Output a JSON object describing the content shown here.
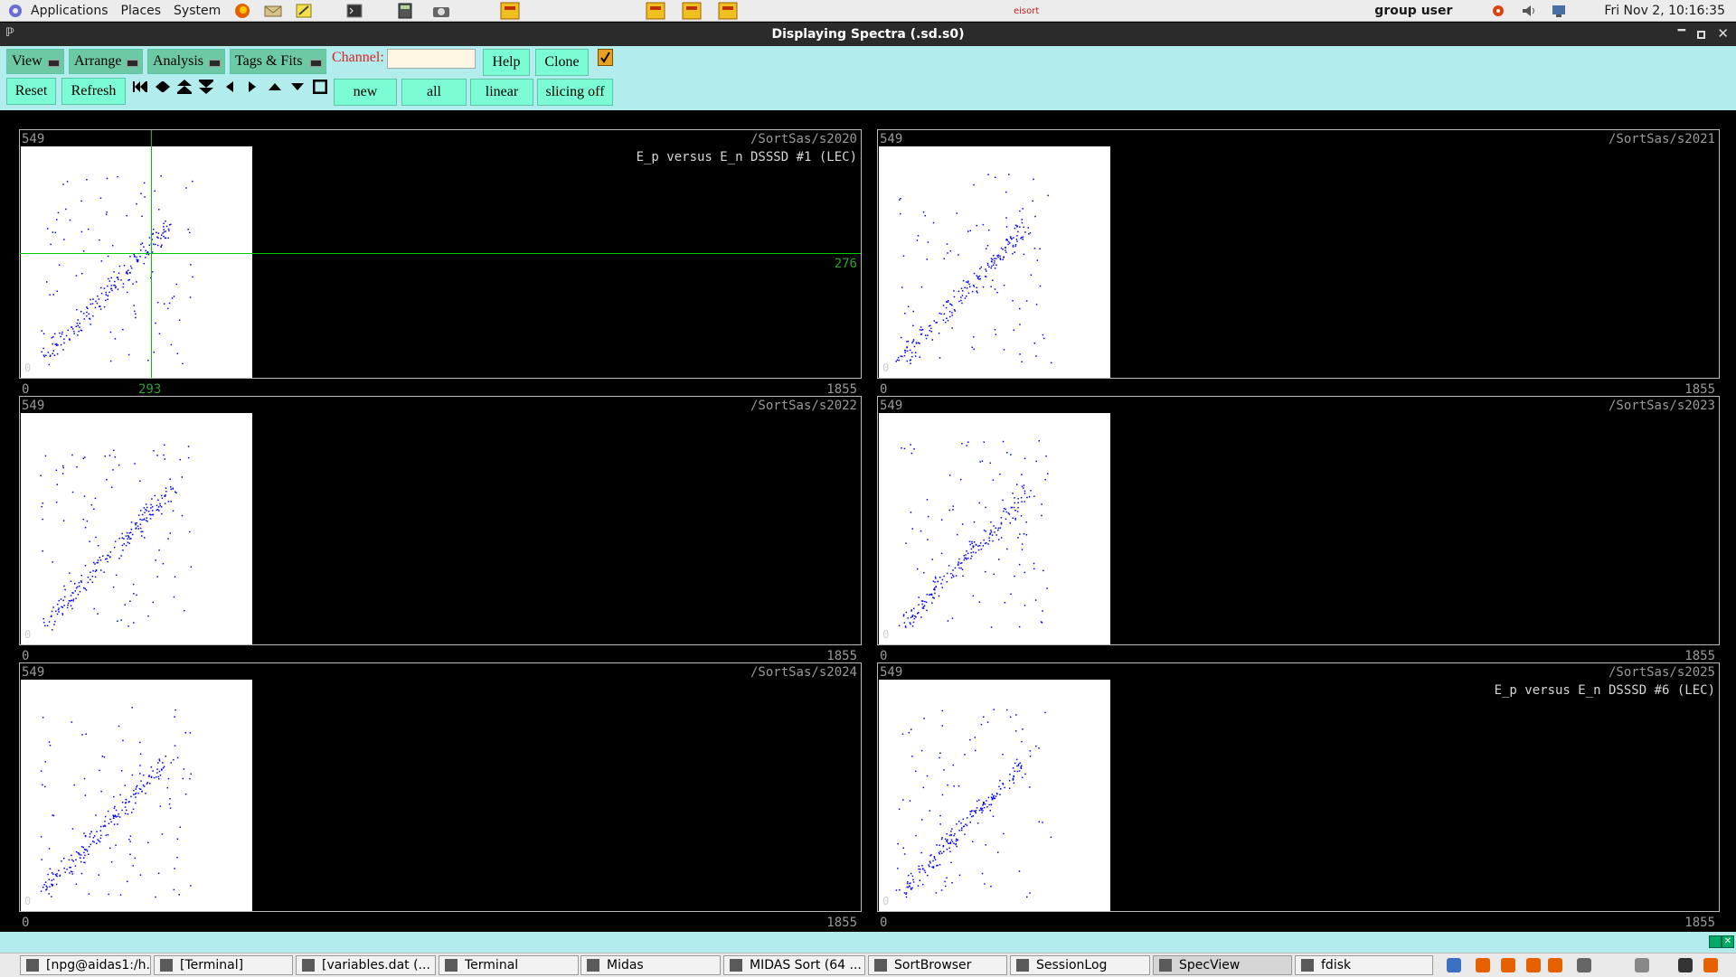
{
  "top_panel": {
    "menus": [
      "Applications",
      "Places",
      "System"
    ],
    "user": "group user",
    "clock": "Fri Nov  2, 10:16:35"
  },
  "window": {
    "title": "Displaying Spectra (.sd.s0)"
  },
  "toolbar": {
    "view": "View",
    "arrange": "Arrange",
    "analysis": "Analysis",
    "tags_fits": "Tags & Fits",
    "channel_label": "Channel:",
    "channel_value": "",
    "help": "Help",
    "clone": "Clone",
    "reset": "Reset",
    "refresh": "Refresh",
    "new": "new",
    "all": "all",
    "linear": "linear",
    "slicing": "slicing off",
    "checkbox_checked": true
  },
  "spectra": [
    {
      "name": "/SortSas/s2020",
      "title": "E_p versus E_n DSSSD #1 (LEC)",
      "y_max": "549",
      "y_min": "0",
      "x_min": "0",
      "x_max": "1855",
      "cursor_x": "293",
      "cursor_y": "276"
    },
    {
      "name": "/SortSas/s2021",
      "title": "",
      "y_max": "549",
      "y_min": "0",
      "x_min": "0",
      "x_max": "1855"
    },
    {
      "name": "/SortSas/s2022",
      "title": "",
      "y_max": "549",
      "y_min": "0",
      "x_min": "0",
      "x_max": "1855"
    },
    {
      "name": "/SortSas/s2023",
      "title": "",
      "y_max": "549",
      "y_min": "0",
      "x_min": "0",
      "x_max": "1855"
    },
    {
      "name": "/SortSas/s2024",
      "title": "",
      "y_max": "549",
      "y_min": "0",
      "x_min": "0",
      "x_max": "1855"
    },
    {
      "name": "/SortSas/s2025",
      "title": "E_p versus E_n DSSSD #6 (LEC)",
      "y_max": "549",
      "y_min": "0",
      "x_min": "0",
      "x_max": "1855"
    }
  ],
  "taskbar": {
    "items": [
      "[npg@aidas1:/h...",
      "[Terminal]",
      "[variables.dat (...",
      "Terminal",
      "Midas",
      "MIDAS Sort (64 ...",
      "SortBrowser",
      "SessionLog",
      "SpecView",
      "fdisk"
    ],
    "active": "SpecView"
  },
  "colors": {
    "toolbar_bg": "#b2ecec",
    "button": "#7cfcd4",
    "plot_points": "#0000ff",
    "cursor": "#00c800"
  }
}
